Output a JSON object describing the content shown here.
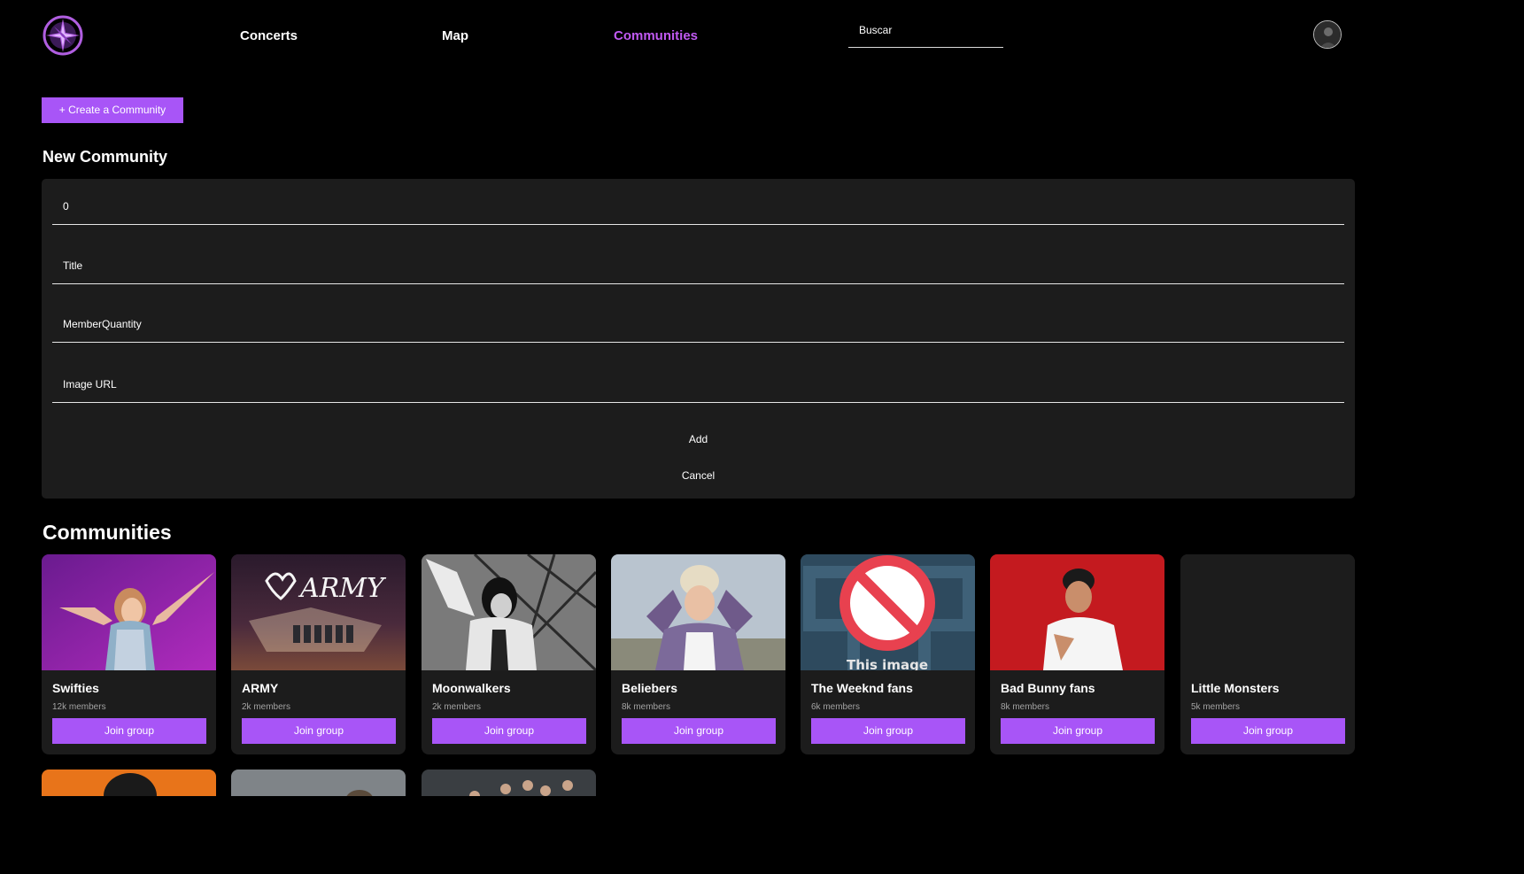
{
  "header": {
    "nav": [
      {
        "label": "Concerts"
      },
      {
        "label": "Map"
      },
      {
        "label": "Communities"
      }
    ],
    "search_value": "Buscar"
  },
  "create_button": "+ Create a Community",
  "new_community": {
    "title": "New Community",
    "fields": [
      "0",
      "Title",
      "MemberQuantity",
      "Image URL"
    ],
    "add_label": "Add",
    "cancel_label": "Cancel"
  },
  "communities": {
    "title": "Communities",
    "join_label": "Join group",
    "cards": [
      {
        "name": "Swifties",
        "members": "12k members"
      },
      {
        "name": "ARMY",
        "members": "2k members",
        "image_text": "ARMY"
      },
      {
        "name": "Moonwalkers",
        "members": "2k members"
      },
      {
        "name": "Beliebers",
        "members": "8k members"
      },
      {
        "name": "The Weeknd fans",
        "members": "6k members",
        "image_text": "This image"
      },
      {
        "name": "Bad Bunny fans",
        "members": "8k members"
      },
      {
        "name": "Little Monsters",
        "members": "5k members"
      }
    ]
  },
  "colors": {
    "accent": "#a855f7",
    "nav_active": "#c15af2",
    "panel": "#1c1c1c",
    "background": "#000000"
  }
}
